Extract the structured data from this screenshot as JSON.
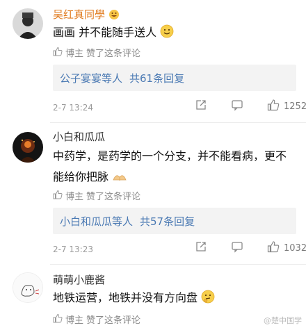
{
  "comments": [
    {
      "username": "吴红真同學",
      "username_badge": "emoji-grin-icon",
      "content": "画画 并不能随手送人",
      "content_emoji": "smile-emoji",
      "liked_by": "博主",
      "liked_text": "赞了这条评论",
      "reply_users": "公子宴宴等人",
      "reply_count": "共61条回复",
      "timestamp": "2-7 13:24",
      "likes": "1252"
    },
    {
      "username": "小白和瓜瓜",
      "content": "中药学，是药学的一个分支，并不能看病，更不能给你把脉",
      "content_emoji": "praying-hands-emoji",
      "liked_by": "博主",
      "liked_text": "赞了这条评论",
      "reply_users": "小白和瓜瓜等人",
      "reply_count": "共57条回复",
      "timestamp": "2-7 13:23",
      "likes": "1032"
    },
    {
      "username": "萌萌小鹿酱",
      "content": "地铁运营，地铁并没有方向盘",
      "content_emoji": "thinking-emoji",
      "liked_by": "博主",
      "liked_text": "赞了这条评论"
    }
  ],
  "watermark": "@楚中国学"
}
